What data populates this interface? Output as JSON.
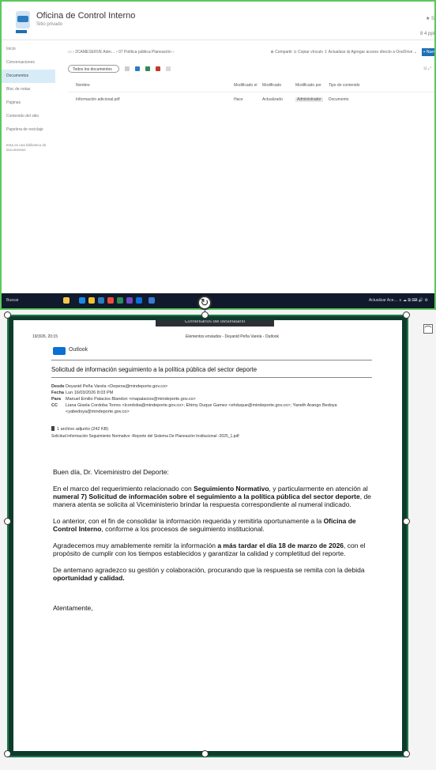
{
  "sharepoint": {
    "site_title": "Oficina de Control Interno",
    "site_subtitle": "Sitio privado",
    "header_right_1": "★ S",
    "header_right_2": "8 4 ppl",
    "nav": [
      "Inicio",
      "Conversaciones",
      "Documentos",
      "Bloc de notas",
      "Páginas",
      "Contenido del sitio",
      "Papelera de reciclaje"
    ],
    "nav_selected_index": 2,
    "nav_note": "Esta es una biblioteca de documentos",
    "breadcrumb": "▭ › 2CAMESERVE Adm… › 07 Política pública Planeación ›",
    "actions": "⊕ Compartir  ⊙ Copiar vínculo  ↧ Actualizar  ⊞ Agregar acceso directo a OneDrive  ⌄",
    "new_button": "+ Nuevo",
    "filter_label": "Todos los documentos",
    "view_label": "⊡ ⤢",
    "columns": [
      "Nombre",
      "Modificado el",
      "Modificado",
      "Modificado por",
      "Tipo de contenido"
    ],
    "row": {
      "name": "Información adicional.pdf",
      "modified": "Hace",
      "by": "Actualizado",
      "author": "Administrador",
      "type": "Documento"
    },
    "taskbar_search": "Buscar",
    "taskbar_tray": "Actualizar Ace…  ∧ ☁ ⧉ ⌨ 🔊 ⚙"
  },
  "outlook": {
    "print_tab": "Comentarios del destinatario",
    "print_date": "19/3/26, 20:15",
    "print_header": "Elementos enviados - Deyanid Peña Varela - Outlook",
    "app_name": "Outlook",
    "subject": "Solicitud de información seguimiento a la política pública del sector deporte",
    "from_label": "Desde",
    "from": "Deyanid Peña Varela <Depena@mindeporte.gov.co>",
    "date_label": "Fecha",
    "date": "Lun 16/03/2026 8:03 PM",
    "to_label": "Para",
    "to": "Manuel Emilio Palacios Blandon <mapalacios@mindeporte.gov.co>",
    "cc_label": "CC",
    "cc": "Liana Gisela Cordoba Torres <lcordoba@mindeporte.gov.co>; Ehimy Duque Gamez <ehduque@mindeporte.gov.co>; Yaneth Arango Bedoya <yabedoya@mindeporte.gov.co>",
    "attachment_count": "1 archivo adjunto (242 KB)",
    "attachment_name": "Solicitud información Seguimiento Normativo -Reporte del Sistema De Planeación Institucional -2025_1.pdf",
    "greeting": "Buen día, Dr. Viceministro del Deporte:",
    "p1": [
      {
        "t": "En el marco del requerimiento relacionado con ",
        "b": false
      },
      {
        "t": "Seguimiento Normativo",
        "b": true
      },
      {
        "t": ", y particularmente en atención al ",
        "b": false
      },
      {
        "t": "numeral 7) Solicitud de información sobre el seguimiento a la política pública del sector deporte",
        "b": true
      },
      {
        "t": ", de manera atenta se solicita al Viceministerio brindar la respuesta correspondiente al numeral indicado.",
        "b": false
      }
    ],
    "p2": [
      {
        "t": "Lo anterior, con el fin de consolidar la información requerida y remitirla oportunamente a la ",
        "b": false
      },
      {
        "t": "Oficina de Control Interno",
        "b": true
      },
      {
        "t": ", conforme a los procesos de seguimiento institucional.",
        "b": false
      }
    ],
    "p3": [
      {
        "t": "Agradecemos muy amablemente remitir la información ",
        "b": false
      },
      {
        "t": "a más tardar el día 18 de marzo de 2026",
        "b": true
      },
      {
        "t": ", con el propósito de cumplir con los tiempos establecidos y garantizar la calidad y completitud del reporte.",
        "b": false
      }
    ],
    "p4": [
      {
        "t": "De antemano agradezco su gestión y colaboración, procurando que la respuesta se remita con la debida ",
        "b": false
      },
      {
        "t": "oportunidad y calidad.",
        "b": true
      }
    ],
    "closing": "Atentamente,"
  },
  "colors": {
    "frame_border": "#5cc85c",
    "selection_border": "#1d7a4a",
    "accent": "#1f6fb5"
  }
}
